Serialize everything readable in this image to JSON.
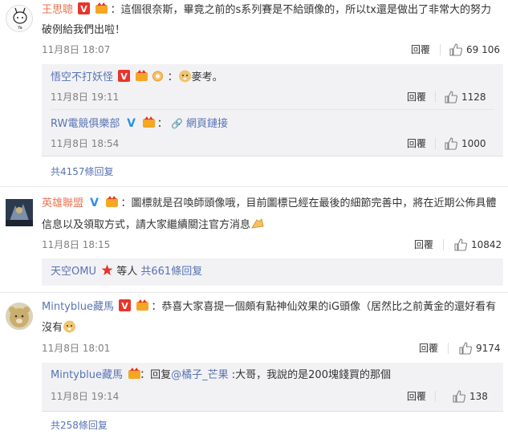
{
  "comments": [
    {
      "user": "王思聰",
      "text_line1": "：這個很奈斯，畢竟之前的s系列賽是不給頭像的，所以tx還是做出了非常大的努力",
      "text_line2": "破例給我們出啦！",
      "time": "11月8日 18:07",
      "reply_label": "回覆",
      "likes": "69 106",
      "replies": [
        {
          "user": "悟空不打妖怪",
          "text": "麥考。",
          "time": "11月8日 19:11",
          "reply_label": "回覆",
          "likes": "1128"
        },
        {
          "user": "RW電競俱樂部",
          "link_text": "網頁鏈接",
          "time": "11月8日 18:54",
          "reply_label": "回覆",
          "likes": "1000"
        }
      ],
      "more": "共4157條回复"
    },
    {
      "user": "英雄聯盟",
      "text_line1": "：圖標就是召喚師頭像哦，目前圖標已經在最後的細節完善中，將在近期公佈具體",
      "text_line2": "信息以及領取方式，請大家繼續關注官方消息",
      "time": "11月8日 18:15",
      "reply_label": "回覆",
      "likes": "10842",
      "more_user": "天空OMU",
      "more_mid": " 等人 ",
      "more": "共661條回复"
    },
    {
      "user": "Mintyblue藏馬",
      "text_line1": "：恭喜大家喜提一個頗有點神仙效果的iG頭像（居然比之前黃金的還好看有",
      "text_line2": "沒有",
      "time": "11月8日 18:01",
      "reply_label": "回覆",
      "likes": "9174",
      "replies": [
        {
          "user": "Mintyblue藏馬",
          "text_prefix": "：回复",
          "mention": "@橘子_芒果",
          "text": " :大哥，我說的是200塊錢買的那個",
          "time": "11月8日 19:14",
          "reply_label": "回覆",
          "likes": "138"
        }
      ],
      "more": "共258條回复"
    }
  ],
  "colors": {
    "username": "#eb7350",
    "link": "#5873b3",
    "reply_bg": "#f2f2f5"
  }
}
